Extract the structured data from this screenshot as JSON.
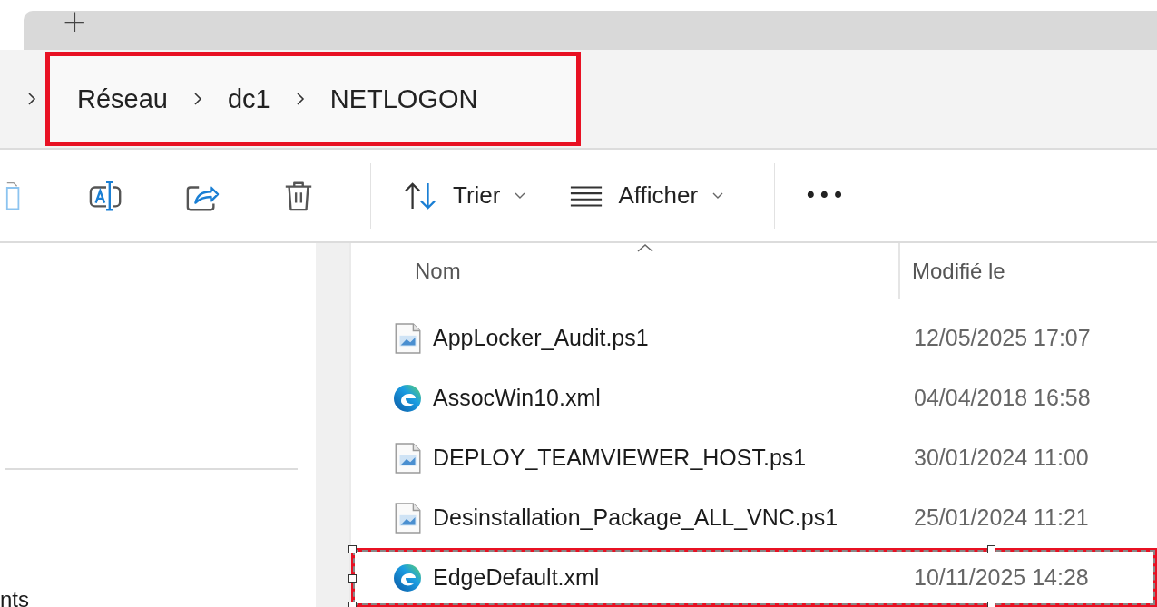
{
  "tab_bar": {
    "new_tab": "+"
  },
  "address_bar": {
    "highlighted": true,
    "breadcrumb": [
      {
        "label": "Réseau"
      },
      {
        "label": "dc1"
      },
      {
        "label": "NETLOGON"
      }
    ]
  },
  "toolbar": {
    "sort": {
      "label": "Trier"
    },
    "view": {
      "label": "Afficher"
    },
    "more": "•••"
  },
  "navigation_pane": {
    "items": [
      {
        "label": "nts"
      }
    ]
  },
  "file_list": {
    "columns": [
      {
        "label": "Nom",
        "sorted": true
      },
      {
        "label": "Modifié le",
        "sorted": false
      }
    ],
    "rows": [
      {
        "kind": "script",
        "name": "AppLocker_Audit.ps1",
        "modified": "12/05/2025 17:07",
        "highlighted": false
      },
      {
        "kind": "edge",
        "name": "AssocWin10.xml",
        "modified": "04/04/2018 16:58",
        "highlighted": false
      },
      {
        "kind": "script",
        "name": "DEPLOY_TEAMVIEWER_HOST.ps1",
        "modified": "30/01/2024 11:00",
        "highlighted": false
      },
      {
        "kind": "script",
        "name": "Desinstallation_Package_ALL_VNC.ps1",
        "modified": "25/01/2024 11:21",
        "highlighted": false
      },
      {
        "kind": "edge",
        "name": "EdgeDefault.xml",
        "modified": "10/11/2025 14:28",
        "highlighted": true
      }
    ]
  }
}
